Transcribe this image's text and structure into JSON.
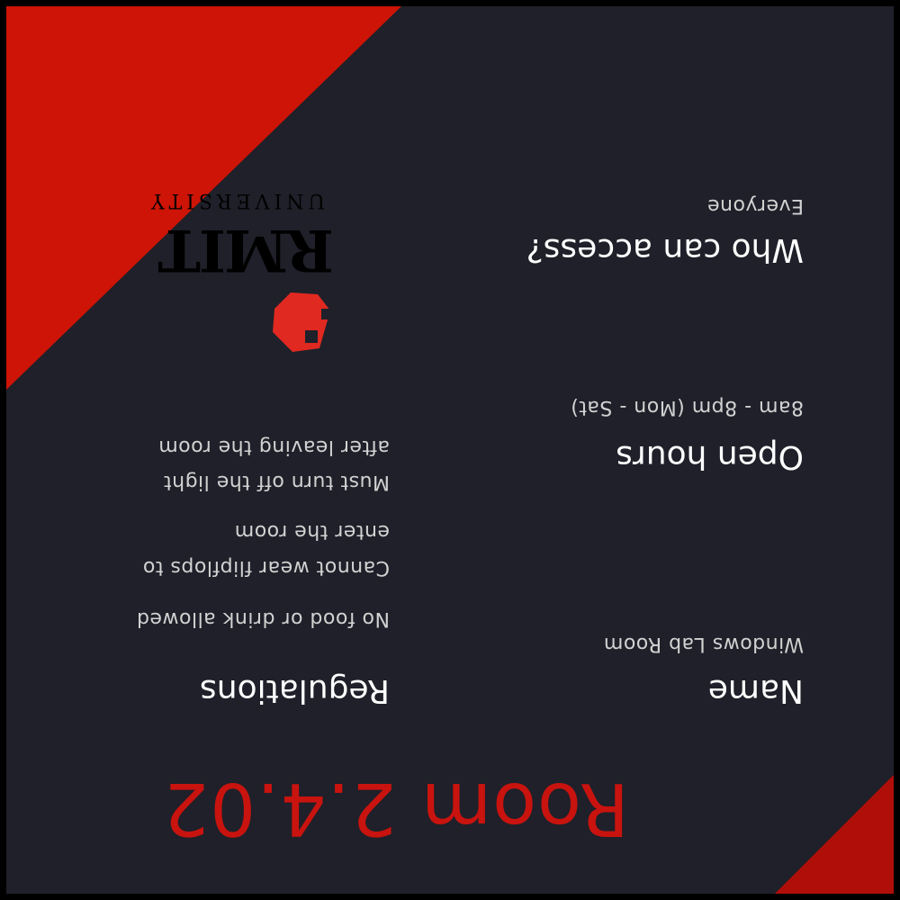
{
  "room": {
    "title": "Room 2.4.02"
  },
  "fields": [
    {
      "heading": "Name",
      "value": "Windows Lab Room"
    },
    {
      "heading": "Open hours",
      "value": "8am - 8pm (Mon - Sat)"
    },
    {
      "heading": "Who can access?",
      "value": "Everyone"
    }
  ],
  "regulations": {
    "heading": "Regulations",
    "rules": [
      "No food or drink allowed",
      "Cannot wear flipflops to",
      "enter the room",
      "Must turn off the light",
      "after leaving the room"
    ]
  },
  "logo": {
    "wordmark": "RMIT",
    "subtitle": "UNIVERSITY"
  },
  "colors": {
    "background": "#1f2029",
    "accent_red": "#c8130f",
    "frame": "#000000"
  }
}
